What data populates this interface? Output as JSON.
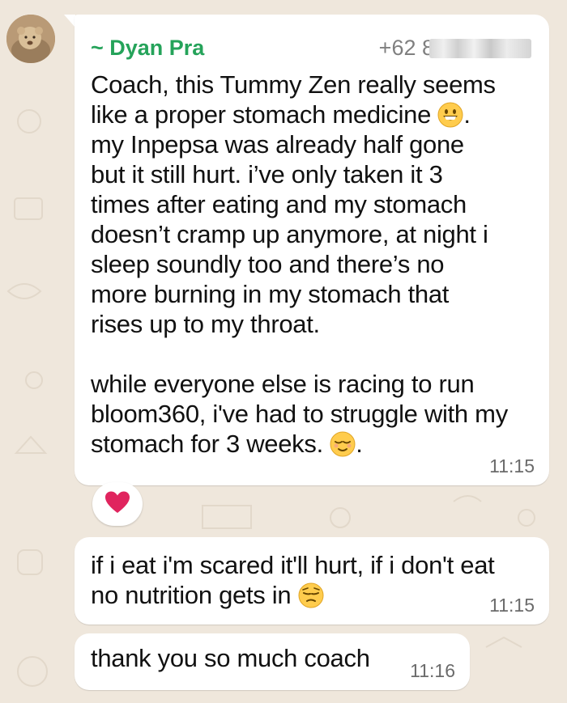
{
  "sender": {
    "name": "~ Dyan Pra",
    "phone": "+62 8"
  },
  "messages": [
    {
      "text_1": "Coach, this Tummy Zen really seems\nlike a proper stomach medicine ",
      "emoji_1": "grinning-face",
      "text_2": ".\nmy Inpepsa was already half gone\nbut it still hurt. i’ve only taken it 3\ntimes after eating and my stomach\ndoesn’t cramp up anymore, at night i\nsleep soundly too and there’s no\nmore burning in my stomach that\nrises up to my throat.\n\nwhile everyone else is racing to run\nbloom360, i've had to struggle with my\nstomach for 3 weeks. ",
      "emoji_2": "relieved-face",
      "text_3": ".",
      "time": "11:15",
      "reaction": "red-heart"
    },
    {
      "text_1": "if i eat i'm scared it'll hurt, if i don't eat\nno nutrition gets in ",
      "emoji_1": "pensive-face",
      "time": "11:15"
    },
    {
      "text_1": "thank you so much coach",
      "time": "11:16"
    }
  ],
  "colors": {
    "background": "#efe7dc",
    "bubble": "#ffffff",
    "sender_name": "#25a35a",
    "timestamp": "#6b6b6b",
    "reaction_heart": "#e0245e"
  }
}
